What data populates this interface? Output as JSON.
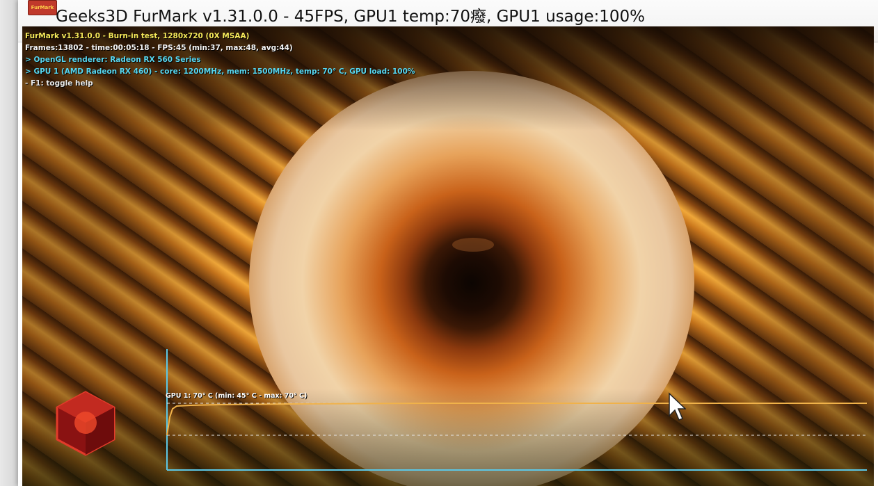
{
  "window": {
    "title": "Geeks3D FurMark v1.31.0.0 - 45FPS, GPU1 temp:70癈, GPU1 usage:100%",
    "icon_name": "furmark-logo-icon",
    "icon_text": "FurMark",
    "controls": {
      "minimize_icon": "minimize-icon",
      "maximize_icon": "maximize-icon",
      "close_icon": "close-icon"
    }
  },
  "hud": {
    "line1": "FurMark v1.31.0.0 - Burn-in test, 1280x720 (0X MSAA)",
    "line2": "Frames:13802 - time:00:05:18 - FPS:45 (min:37, max:48, avg:44)",
    "line3": "> OpenGL renderer: Radeon RX 560 Series",
    "line4": "> GPU 1 (AMD Radeon RX 460) - core: 1200MHz, mem: 1500MHz, temp: 70° C, GPU load: 100%",
    "line5": "- F1: toggle help"
  },
  "temperature_graph": {
    "label": "GPU 1: 70° C (min: 45° C - max: 70° C)",
    "current_c": 70,
    "min_c": 45,
    "max_c": 70,
    "line_color": "#f0b24a",
    "axis_color": "#5cc8e6"
  },
  "colors": {
    "hud_title": "#f6e95a",
    "hud_info": "#58d7f0",
    "accent_orange": "#e7922a"
  }
}
